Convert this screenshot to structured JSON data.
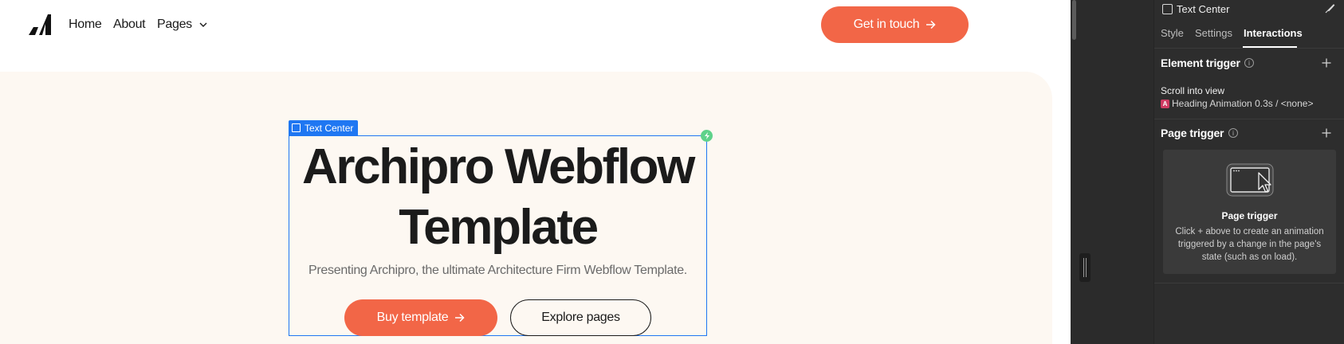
{
  "nav": {
    "home": "Home",
    "about": "About",
    "pages": "Pages",
    "cta": "Get in touch"
  },
  "hero": {
    "title_line1": "Archipro Webflow",
    "title_line2": "Template",
    "subtitle": "Presenting Archipro, the ultimate Architecture Firm Webflow Template.",
    "primary_button": "Buy template",
    "secondary_button": "Explore pages"
  },
  "selection": {
    "label": "Text Center"
  },
  "panel": {
    "element_name": "Text Center",
    "tabs": {
      "style": "Style",
      "settings": "Settings",
      "interactions": "Interactions"
    },
    "element_trigger": {
      "title": "Element trigger",
      "trigger": "Scroll into view",
      "animation": "Heading Animation 0.3s / <none>"
    },
    "page_trigger": {
      "title": "Page trigger",
      "empty_title": "Page trigger",
      "empty_text": "Click + above to create an animation triggered by a change in the page's state (such as on load)."
    }
  },
  "colors": {
    "accent": "#f26647",
    "hero_bg": "#fdf8f2",
    "selection": "#1f77f2",
    "panel_bg": "#2d2d2d"
  }
}
